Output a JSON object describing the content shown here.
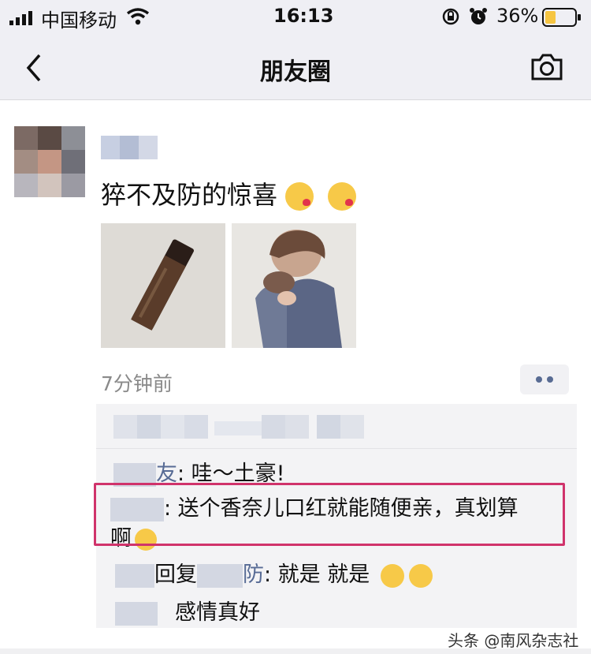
{
  "status_bar": {
    "carrier": "中国移动",
    "time": "16:13",
    "battery_percent": "36%",
    "battery_level": 0.36
  },
  "nav": {
    "title": "朋友圈",
    "back_icon": "chevron-left-icon",
    "camera_icon": "camera-icon"
  },
  "post": {
    "text": "猝不及防的惊喜",
    "emojis": [
      "kiss-emoji",
      "kiss-emoji"
    ],
    "time": "7分钟前",
    "images": [
      "lipstick-photo",
      "couple-photo"
    ]
  },
  "comments": [
    {
      "name_suffix": "友",
      "text": ": 哇～土豪!"
    },
    {
      "text_line1": ": 送个香奈儿口红就能随便亲，真划算",
      "text_line2": "啊"
    },
    {
      "reply_word": "回复",
      "name_suffix": "防",
      "text": ": 就是 就是"
    },
    {
      "text": "感情真好"
    }
  ],
  "watermark": "头条 @南风杂志社",
  "colors": {
    "name_link": "#576b95",
    "highlight_border": "#d0336b",
    "battery": "#f6c542"
  }
}
